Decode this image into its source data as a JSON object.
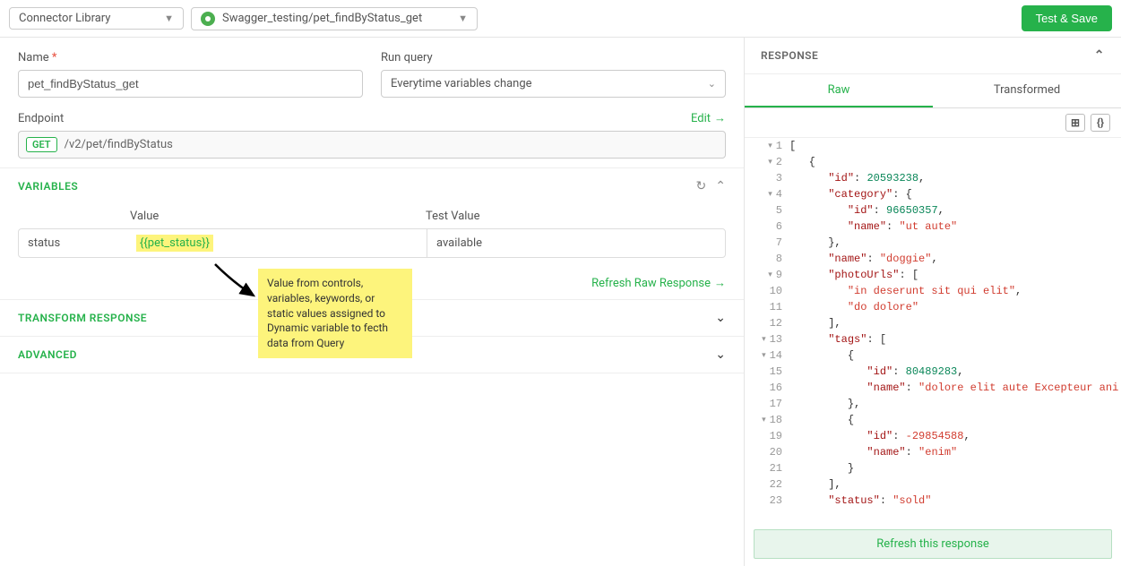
{
  "topbar": {
    "connector_label": "Connector Library",
    "path_label": "Swagger_testing/pet_findByStatus_get",
    "test_save": "Test & Save"
  },
  "form": {
    "name_label": "Name",
    "name_value": "pet_findByStatus_get",
    "run_query_label": "Run query",
    "run_query_value": "Everytime variables change",
    "endpoint_label": "Endpoint",
    "edit": "Edit",
    "method": "GET",
    "endpoint_path": "/v2/pet/findByStatus"
  },
  "variables": {
    "title": "VARIABLES",
    "col_value": "Value",
    "col_test": "Test Value",
    "row": {
      "name": "status",
      "value": "{{pet_status}}",
      "test": "available"
    },
    "refresh": "Refresh Raw Response"
  },
  "tooltip": "Value from controls, variables, keywords, or static values assigned to Dynamic variable to fecth data from Query",
  "sections": {
    "transform": "TRANSFORM RESPONSE",
    "advanced": "ADVANCED"
  },
  "response": {
    "title": "RESPONSE",
    "tab_raw": "Raw",
    "tab_transformed": "Transformed",
    "refresh_footer": "Refresh this response"
  },
  "chart_data": {
    "type": "json",
    "lines": [
      {
        "n": 1,
        "fold": "▾",
        "indent": 0,
        "tokens": [
          {
            "t": "[",
            "c": "punct"
          }
        ]
      },
      {
        "n": 2,
        "fold": "▾",
        "indent": 1,
        "tokens": [
          {
            "t": "{",
            "c": "punct"
          }
        ]
      },
      {
        "n": 3,
        "fold": "",
        "indent": 2,
        "tokens": [
          {
            "t": "\"id\"",
            "c": "key"
          },
          {
            "t": ": ",
            "c": "punct"
          },
          {
            "t": "20593238",
            "c": "num"
          },
          {
            "t": ",",
            "c": "punct"
          }
        ]
      },
      {
        "n": 4,
        "fold": "▾",
        "indent": 2,
        "tokens": [
          {
            "t": "\"category\"",
            "c": "key"
          },
          {
            "t": ": {",
            "c": "punct"
          }
        ]
      },
      {
        "n": 5,
        "fold": "",
        "indent": 3,
        "tokens": [
          {
            "t": "\"id\"",
            "c": "key"
          },
          {
            "t": ": ",
            "c": "punct"
          },
          {
            "t": "96650357",
            "c": "num"
          },
          {
            "t": ",",
            "c": "punct"
          }
        ]
      },
      {
        "n": 6,
        "fold": "",
        "indent": 3,
        "tokens": [
          {
            "t": "\"name\"",
            "c": "key"
          },
          {
            "t": ": ",
            "c": "punct"
          },
          {
            "t": "\"ut aute\"",
            "c": "str"
          }
        ]
      },
      {
        "n": 7,
        "fold": "",
        "indent": 2,
        "tokens": [
          {
            "t": "},",
            "c": "punct"
          }
        ]
      },
      {
        "n": 8,
        "fold": "",
        "indent": 2,
        "tokens": [
          {
            "t": "\"name\"",
            "c": "key"
          },
          {
            "t": ": ",
            "c": "punct"
          },
          {
            "t": "\"doggie\"",
            "c": "str"
          },
          {
            "t": ",",
            "c": "punct"
          }
        ]
      },
      {
        "n": 9,
        "fold": "▾",
        "indent": 2,
        "tokens": [
          {
            "t": "\"photoUrls\"",
            "c": "key"
          },
          {
            "t": ": [",
            "c": "punct"
          }
        ]
      },
      {
        "n": 10,
        "fold": "",
        "indent": 3,
        "tokens": [
          {
            "t": "\"in deserunt sit qui elit\"",
            "c": "str"
          },
          {
            "t": ",",
            "c": "punct"
          }
        ]
      },
      {
        "n": 11,
        "fold": "",
        "indent": 3,
        "tokens": [
          {
            "t": "\"do dolore\"",
            "c": "str"
          }
        ]
      },
      {
        "n": 12,
        "fold": "",
        "indent": 2,
        "tokens": [
          {
            "t": "],",
            "c": "punct"
          }
        ]
      },
      {
        "n": 13,
        "fold": "▾",
        "indent": 2,
        "tokens": [
          {
            "t": "\"tags\"",
            "c": "key"
          },
          {
            "t": ": [",
            "c": "punct"
          }
        ]
      },
      {
        "n": 14,
        "fold": "▾",
        "indent": 3,
        "tokens": [
          {
            "t": "{",
            "c": "punct"
          }
        ]
      },
      {
        "n": 15,
        "fold": "",
        "indent": 4,
        "tokens": [
          {
            "t": "\"id\"",
            "c": "key"
          },
          {
            "t": ": ",
            "c": "punct"
          },
          {
            "t": "80489283",
            "c": "num"
          },
          {
            "t": ",",
            "c": "punct"
          }
        ]
      },
      {
        "n": 16,
        "fold": "",
        "indent": 4,
        "tokens": [
          {
            "t": "\"name\"",
            "c": "key"
          },
          {
            "t": ": ",
            "c": "punct"
          },
          {
            "t": "\"dolore elit aute Excepteur ani",
            "c": "str"
          }
        ]
      },
      {
        "n": 17,
        "fold": "",
        "indent": 3,
        "tokens": [
          {
            "t": "},",
            "c": "punct"
          }
        ]
      },
      {
        "n": 18,
        "fold": "▾",
        "indent": 3,
        "tokens": [
          {
            "t": "{",
            "c": "punct"
          }
        ]
      },
      {
        "n": 19,
        "fold": "",
        "indent": 4,
        "tokens": [
          {
            "t": "\"id\"",
            "c": "key"
          },
          {
            "t": ": ",
            "c": "punct"
          },
          {
            "t": "-29854588",
            "c": "numneg"
          },
          {
            "t": ",",
            "c": "punct"
          }
        ]
      },
      {
        "n": 20,
        "fold": "",
        "indent": 4,
        "tokens": [
          {
            "t": "\"name\"",
            "c": "key"
          },
          {
            "t": ": ",
            "c": "punct"
          },
          {
            "t": "\"enim\"",
            "c": "str"
          }
        ]
      },
      {
        "n": 21,
        "fold": "",
        "indent": 3,
        "tokens": [
          {
            "t": "}",
            "c": "punct"
          }
        ]
      },
      {
        "n": 22,
        "fold": "",
        "indent": 2,
        "tokens": [
          {
            "t": "],",
            "c": "punct"
          }
        ]
      },
      {
        "n": 23,
        "fold": "",
        "indent": 2,
        "tokens": [
          {
            "t": "\"status\"",
            "c": "key"
          },
          {
            "t": ": ",
            "c": "punct"
          },
          {
            "t": "\"sold\"",
            "c": "str"
          }
        ]
      }
    ]
  }
}
